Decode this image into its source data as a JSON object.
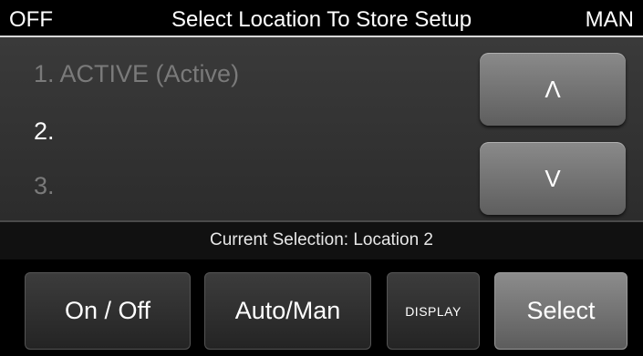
{
  "header": {
    "mode_left": "OFF",
    "title": "Select Location To Store Setup",
    "mode_right": "MAN"
  },
  "list": {
    "items": [
      {
        "label": "1. ACTIVE (Active)",
        "state": "dimmed"
      },
      {
        "label": "2.",
        "state": "selected"
      },
      {
        "label": "3.",
        "state": "dimmed"
      }
    ],
    "up_label": "Λ",
    "down_label": "V"
  },
  "status": {
    "text": "Current Selection: Location 2"
  },
  "buttons": {
    "onoff": "On / Off",
    "automan": "Auto/Man",
    "display": "DISPLAY",
    "select": "Select"
  },
  "colors": {
    "background": "#000000",
    "panel": "#333333",
    "selected_text": "#ffffff",
    "dimmed_text": "#7a7a7a",
    "button_gray": "#6e6e6e"
  }
}
